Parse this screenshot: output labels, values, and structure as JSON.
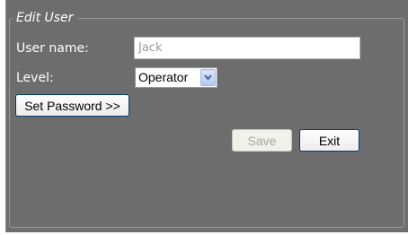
{
  "form": {
    "legend": "Edit User",
    "username_label": "User name:",
    "username_value": "Jack",
    "level_label": "Level:",
    "level_selected": "Operator",
    "set_password_label": "Set Password >>",
    "save_label": "Save",
    "exit_label": "Exit"
  },
  "icons": {
    "dropdown": "chevron-down-icon"
  },
  "colors": {
    "panel_background": "#6d6d6d",
    "label_text": "#ffffff",
    "disabled_text": "#a7a6a0",
    "dropdown_arrow": "#4d6185"
  }
}
